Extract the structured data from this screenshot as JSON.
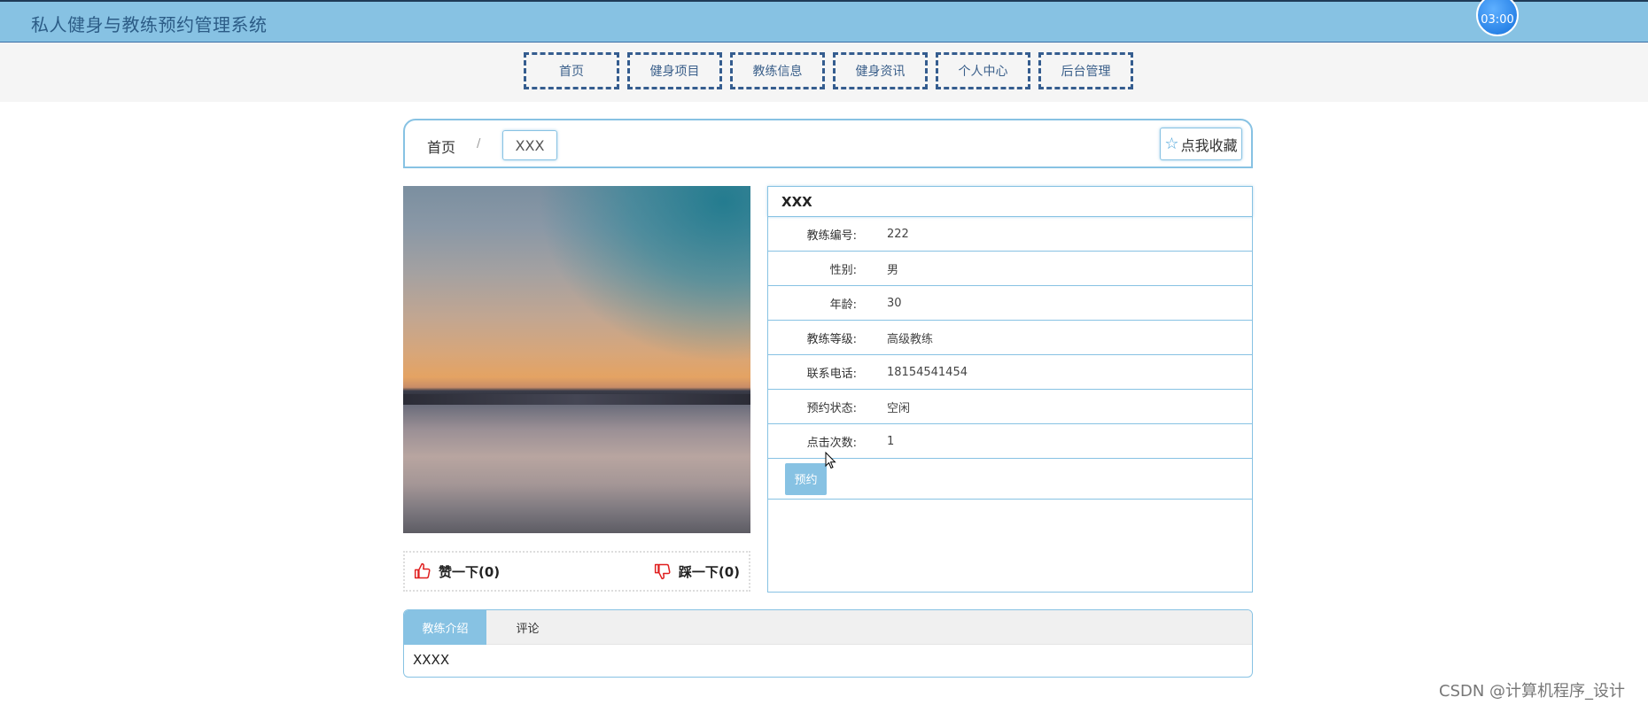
{
  "header": {
    "app_title": "私人健身与教练预约管理系统",
    "clock": "03:00"
  },
  "nav": {
    "items": [
      "首页",
      "健身项目",
      "教练信息",
      "健身资讯",
      "个人中心",
      "后台管理"
    ]
  },
  "breadcrumb": {
    "home": "首页",
    "separator": "/",
    "current": "XXX"
  },
  "favorite": {
    "label": "点我收藏",
    "icon": "star-outline-icon"
  },
  "photo": {
    "description_icon": "coach-photo"
  },
  "votes": {
    "like_label": "赞一下(0)",
    "like_icon": "thumbs-up-icon",
    "dislike_label": "踩一下(0)",
    "dislike_icon": "thumbs-down-icon"
  },
  "details": {
    "title": "XXX",
    "rows": [
      {
        "key": "教练编号:",
        "value": "222"
      },
      {
        "key": "性别:",
        "value": "男"
      },
      {
        "key": "年龄:",
        "value": "30"
      },
      {
        "key": "教练等级:",
        "value": "高级教练"
      },
      {
        "key": "联系电话:",
        "value": "18154541454"
      },
      {
        "key": "预约状态:",
        "value": "空闲"
      },
      {
        "key": "点击次数:",
        "value": "1"
      }
    ],
    "book_button": "预约"
  },
  "tabs": {
    "items": [
      "教练介绍",
      "评论"
    ],
    "active_index": 0,
    "content": "XXXX"
  },
  "colors": {
    "accent": "#87c2e3",
    "nav_border": "#355d8f",
    "thumb_red": "#e02020"
  },
  "watermark": "CSDN @计算机程序_设计"
}
